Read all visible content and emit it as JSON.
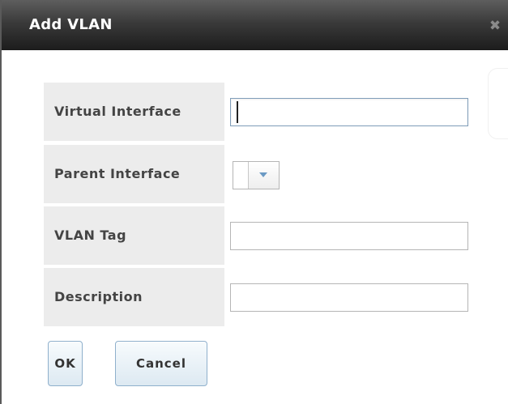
{
  "dialog": {
    "title": "Add VLAN",
    "close_icon": "close-icon"
  },
  "form": {
    "fields": [
      {
        "label": "Virtual Interface",
        "value": "",
        "type": "text",
        "focused": true
      },
      {
        "label": "Parent Interface",
        "value": "",
        "type": "select"
      },
      {
        "label": "VLAN Tag",
        "value": "",
        "type": "text"
      },
      {
        "label": "Description",
        "value": "",
        "type": "text"
      }
    ]
  },
  "buttons": {
    "ok_label": "OK",
    "cancel_label": "Cancel"
  },
  "colors": {
    "titlebar_dark": "#1c1c1c",
    "label_background": "#ececec",
    "button_border": "#8fb0cc",
    "select_arrow": "#6b9ac4"
  }
}
